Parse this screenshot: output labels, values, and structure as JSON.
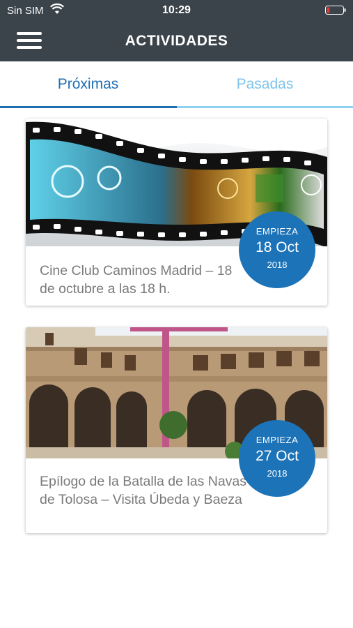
{
  "status_bar": {
    "carrier": "Sin SIM",
    "time": "10:29",
    "battery_color": "#e53935"
  },
  "header": {
    "title": "ACTIVIDADES",
    "menu_icon": "hamburger-icon"
  },
  "tabs": [
    {
      "label": "Próximas",
      "active": true
    },
    {
      "label": "Pasadas",
      "active": false
    }
  ],
  "events": [
    {
      "title": "Cine Club Caminos Madrid – 18 de octubre a las 18 h.",
      "badge": {
        "label": "EMPIEZA",
        "date": "18 Oct",
        "year": "2018"
      },
      "image": "film-strip-image"
    },
    {
      "title": "Epílogo de la Batalla de las Navas de Tolosa – Visita Úbeda y Baeza",
      "badge": {
        "label": "EMPIEZA",
        "date": "27 Oct",
        "year": "2018"
      },
      "image": "cloister-courtyard-image"
    }
  ],
  "colors": {
    "header_bg": "#3b434b",
    "accent": "#1c73b8",
    "tab_inactive": "#7ec4ea"
  }
}
